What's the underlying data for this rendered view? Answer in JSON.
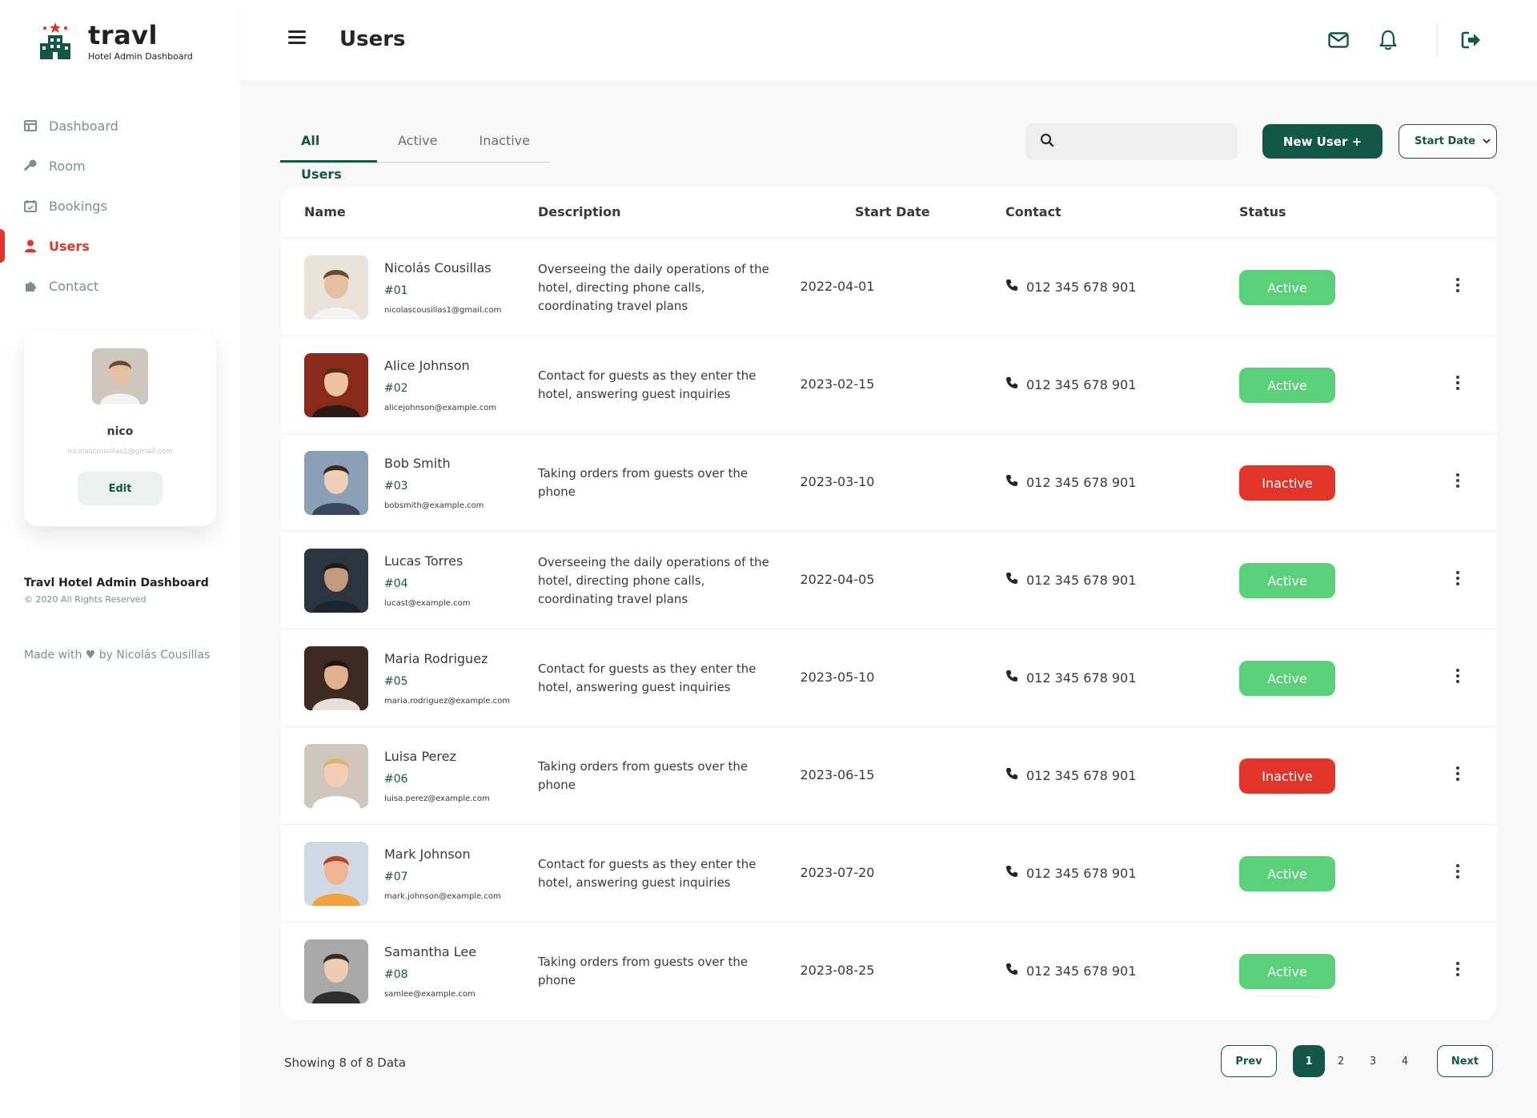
{
  "brand": {
    "name": "travl",
    "subtitle": "Hotel Admin Dashboard"
  },
  "nav": [
    {
      "label": "Dashboard",
      "icon": "dashboard-icon"
    },
    {
      "label": "Room",
      "icon": "key-icon"
    },
    {
      "label": "Bookings",
      "icon": "calendar-icon"
    },
    {
      "label": "Users",
      "icon": "user-icon",
      "active": true
    },
    {
      "label": "Contact",
      "icon": "puzzle-icon"
    }
  ],
  "profile": {
    "name": "nico",
    "email": "nicolascousillas1@gmail.com",
    "edit_label": "Edit"
  },
  "footer": {
    "title": "Travl Hotel Admin Dashboard",
    "copyright": "© 2020 All Rights Reserved",
    "made_with": "Made with ♥ by Nicolás Cousillas"
  },
  "header": {
    "title": "Users"
  },
  "tabs": [
    "All Users",
    "Active",
    "Inactive"
  ],
  "search": {
    "placeholder": ""
  },
  "new_user_label": "New User +",
  "sort_select": {
    "value": "Start Date"
  },
  "table": {
    "headers": {
      "name": "Name",
      "description": "Description",
      "start_date": "Start Date",
      "contact": "Contact",
      "status": "Status"
    },
    "rows": [
      {
        "name": "Nicolás Cousillas",
        "id": "#01",
        "email": "nicolascousillas1@gmail.com",
        "description": "Overseeing the daily operations of the hotel, directing phone calls, coordinating travel plans",
        "start_date": "2022-04-01",
        "contact": "012 345 678 901",
        "status": "Active"
      },
      {
        "name": "Alice Johnson",
        "id": "#02",
        "email": "alicejohnson@example.com",
        "description": "Contact for guests as they enter the hotel, answering guest inquiries",
        "start_date": "2023-02-15",
        "contact": "012 345 678 901",
        "status": "Active"
      },
      {
        "name": "Bob Smith",
        "id": "#03",
        "email": "bobsmith@example.com",
        "description": "Taking orders from guests over the phone",
        "start_date": "2023-03-10",
        "contact": "012 345 678 901",
        "status": "Inactive"
      },
      {
        "name": "Lucas Torres",
        "id": "#04",
        "email": "lucast@example.com",
        "description": "Overseeing the daily operations of the hotel, directing phone calls, coordinating travel plans",
        "start_date": "2022-04-05",
        "contact": "012 345 678 901",
        "status": "Active"
      },
      {
        "name": "Maria Rodriguez",
        "id": "#05",
        "email": "maria.rodriguez@example.com",
        "description": "Contact for guests as they enter the hotel, answering guest inquiries",
        "start_date": "2023-05-10",
        "contact": "012 345 678 901",
        "status": "Active"
      },
      {
        "name": "Luisa Perez",
        "id": "#06",
        "email": "luisa.perez@example.com",
        "description": "Taking orders from guests over the phone",
        "start_date": "2023-06-15",
        "contact": "012 345 678 901",
        "status": "Inactive"
      },
      {
        "name": "Mark Johnson",
        "id": "#07",
        "email": "mark.johnson@example.com",
        "description": "Contact for guests as they enter the hotel, answering guest inquiries",
        "start_date": "2023-07-20",
        "contact": "012 345 678 901",
        "status": "Active"
      },
      {
        "name": "Samantha Lee",
        "id": "#08",
        "email": "samlee@example.com",
        "description": "Taking orders from guests over the phone",
        "start_date": "2023-08-25",
        "contact": "012 345 678 901",
        "status": "Active"
      }
    ]
  },
  "pagination": {
    "showing": "Showing 8 of 8 Data",
    "prev": "Prev",
    "next": "Next",
    "pages": [
      "1",
      "2",
      "3",
      "4"
    ],
    "current": "1"
  },
  "colors": {
    "primary": "#135846",
    "accent": "#e23428",
    "active": "#5ad07a",
    "inactive": "#e23428",
    "muted": "#799283"
  }
}
